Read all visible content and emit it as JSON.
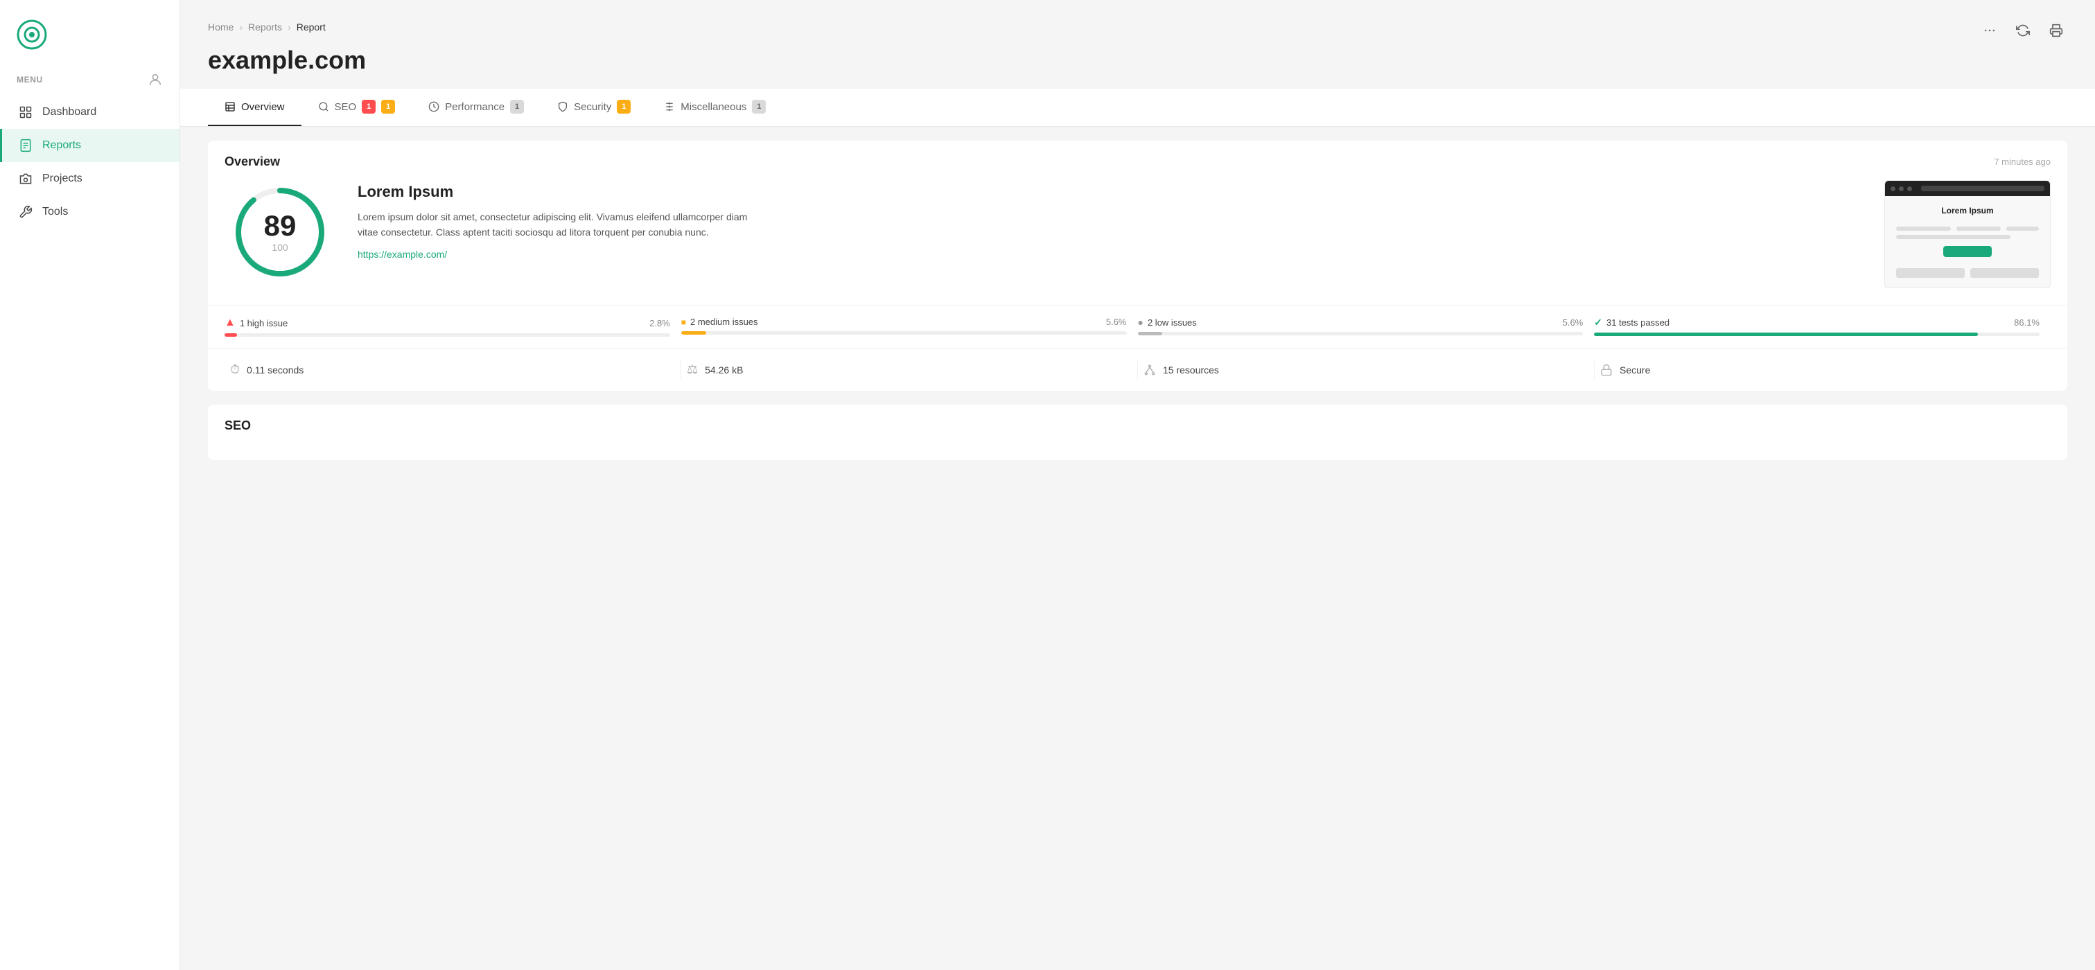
{
  "sidebar": {
    "menu_label": "MENU",
    "nav_items": [
      {
        "id": "dashboard",
        "label": "Dashboard",
        "active": false
      },
      {
        "id": "reports",
        "label": "Reports",
        "active": true
      },
      {
        "id": "projects",
        "label": "Projects",
        "active": false
      },
      {
        "id": "tools",
        "label": "Tools",
        "active": false
      }
    ]
  },
  "breadcrumb": {
    "home": "Home",
    "reports": "Reports",
    "current": "Report"
  },
  "page_title": "example.com",
  "tabs": [
    {
      "id": "overview",
      "label": "Overview",
      "active": true,
      "badges": []
    },
    {
      "id": "seo",
      "label": "SEO",
      "active": false,
      "badges": [
        {
          "type": "red",
          "val": "1"
        },
        {
          "type": "yellow",
          "val": "1"
        }
      ]
    },
    {
      "id": "performance",
      "label": "Performance",
      "active": false,
      "badges": [
        {
          "type": "gray",
          "val": "1"
        }
      ]
    },
    {
      "id": "security",
      "label": "Security",
      "active": false,
      "badges": [
        {
          "type": "yellow",
          "val": "1"
        }
      ]
    },
    {
      "id": "miscellaneous",
      "label": "Miscellaneous",
      "active": false,
      "badges": [
        {
          "type": "gray",
          "val": "1"
        }
      ]
    }
  ],
  "overview": {
    "section_title": "Overview",
    "timestamp": "7 minutes ago",
    "score": {
      "value": "89",
      "max": "100",
      "percent": 89
    },
    "site_name": "Lorem Ipsum",
    "description": "Lorem ipsum dolor sit amet, consectetur adipiscing elit. Vivamus eleifend ullamcorper diam vitae consectetur. Class aptent taciti sociosqu ad litora torquent per conubia nunc.",
    "url": "https://example.com/",
    "preview_title": "Lorem Ipsum",
    "issues": [
      {
        "id": "high",
        "icon": "▲",
        "icon_class": "dot-red",
        "label": "1 high issue",
        "pct": "2.8%",
        "bar_color": "#ff4d4f",
        "bar_width": "2.8"
      },
      {
        "id": "medium",
        "icon": "■",
        "icon_class": "dot-yellow",
        "label": "2 medium issues",
        "pct": "5.6%",
        "bar_color": "#faad14",
        "bar_width": "5.6"
      },
      {
        "id": "low",
        "icon": "●",
        "icon_class": "dot-gray",
        "label": "2 low issues",
        "pct": "5.6%",
        "bar_color": "#bbb",
        "bar_width": "5.6"
      },
      {
        "id": "passed",
        "icon": "✓",
        "icon_class": "dot-green",
        "label": "31 tests passed",
        "pct": "86.1%",
        "bar_color": "#19a97b",
        "bar_width": "86.1"
      }
    ],
    "stats": [
      {
        "id": "time",
        "icon": "⏱",
        "label": "0.11 seconds"
      },
      {
        "id": "size",
        "icon": "⚖",
        "label": "54.26 kB"
      },
      {
        "id": "resources",
        "icon": "⚙",
        "label": "15 resources"
      },
      {
        "id": "secure",
        "icon": "🔒",
        "label": "Secure"
      }
    ]
  },
  "seo_section": {
    "title": "SEO"
  },
  "colors": {
    "accent": "#19a97b",
    "sidebar_active_bg": "#e8f7f2",
    "sidebar_active_text": "#19a97b"
  }
}
